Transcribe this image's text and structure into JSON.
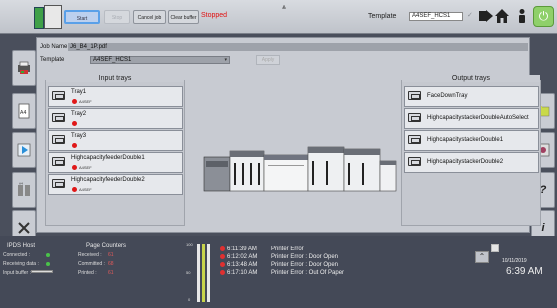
{
  "toolbar": {
    "start_label": "Start",
    "stop_label": "Stop",
    "cancel_label": "Cancel job",
    "clear_label": "Clear buffer",
    "status_text": "Stopped",
    "template_label": "Template",
    "template_value": "A4SEF_HCS1",
    "icons": [
      "collapse-icon",
      "check-icon",
      "arrow-right-icon",
      "home-icon",
      "person-icon",
      "power-icon"
    ]
  },
  "job": {
    "job_name_label": "Job Name",
    "job_name_value": "J6_B4_1P.pdf",
    "template_label": "Template",
    "template_value": "A4SEF_HCS1",
    "apply_label": "Apply"
  },
  "input": {
    "title": "Input trays",
    "trays": [
      {
        "name": "Tray1",
        "sub": "A4SEF"
      },
      {
        "name": "Tray2",
        "sub": ""
      },
      {
        "name": "Tray3",
        "sub": ""
      },
      {
        "name": "HighcapacityfeederDouble1",
        "sub": "A4SEF"
      },
      {
        "name": "HighcapacityfeederDouble2",
        "sub": "A4SEF"
      }
    ]
  },
  "output": {
    "title": "Output trays",
    "trays": [
      {
        "name": "FaceDownTray"
      },
      {
        "name": "HighcapacitystackerDoubleAutoSelect"
      },
      {
        "name": "HighcapacitystackerDouble1"
      },
      {
        "name": "HighcapacitystackerDouble2"
      }
    ]
  },
  "side_left": [
    "printer-icon",
    "document-icon",
    "play-icon",
    "tray-settings-icon",
    "tools-icon"
  ],
  "side_right": [
    "folder-icon",
    "image-icon",
    "help-icon",
    "info-icon"
  ],
  "host": {
    "title": "IPDS Host",
    "connected_label": "Connected :",
    "receiving_label": "Receiving data :",
    "buffer_label": "Input buffer :"
  },
  "counters": {
    "title": "Page Counters",
    "received_label": "Received :",
    "received_value": "61",
    "committed_label": "Committed :",
    "committed_value": "68",
    "printed_label": "Printed :",
    "printed_value": "61"
  },
  "log": [
    {
      "time": "6:11:39 AM",
      "message": "Printer Error"
    },
    {
      "time": "6:12:02 AM",
      "message": "Printer Error : Door Open"
    },
    {
      "time": "6:13:48 AM",
      "message": "Printer Error : Door Open"
    },
    {
      "time": "6:17:10 AM",
      "message": "Printer Error : Out Of Paper"
    }
  ],
  "meter": {
    "ticks": [
      "100",
      "50",
      "0"
    ]
  },
  "datetime": {
    "date": "10/11/2019",
    "time": "6:39 AM"
  },
  "colors": {
    "status_red": "#e01010",
    "accent_blue": "#5aa0e8",
    "power_green": "#8fd06a"
  }
}
